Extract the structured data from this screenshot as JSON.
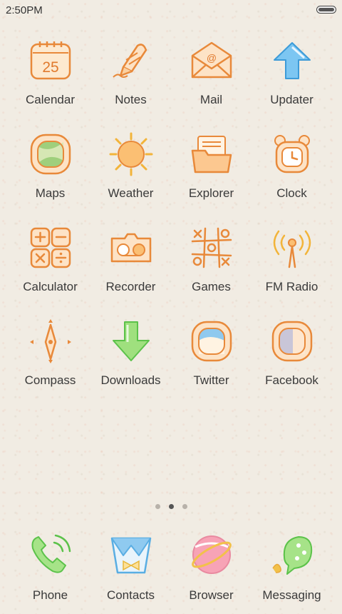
{
  "status_bar": {
    "time": "2:50PM"
  },
  "apps": [
    {
      "label": "Calendar",
      "icon": "calendar-icon",
      "badge": "25"
    },
    {
      "label": "Notes",
      "icon": "notes-icon"
    },
    {
      "label": "Mail",
      "icon": "mail-icon",
      "badge": "@"
    },
    {
      "label": "Updater",
      "icon": "updater-icon"
    },
    {
      "label": "Maps",
      "icon": "maps-icon"
    },
    {
      "label": "Weather",
      "icon": "weather-icon"
    },
    {
      "label": "Explorer",
      "icon": "explorer-icon"
    },
    {
      "label": "Clock",
      "icon": "clock-icon"
    },
    {
      "label": "Calculator",
      "icon": "calculator-icon"
    },
    {
      "label": "Recorder",
      "icon": "recorder-icon"
    },
    {
      "label": "Games",
      "icon": "games-icon"
    },
    {
      "label": "FM Radio",
      "icon": "radio-icon"
    },
    {
      "label": "Compass",
      "icon": "compass-icon"
    },
    {
      "label": "Downloads",
      "icon": "downloads-icon"
    },
    {
      "label": "Twitter",
      "icon": "twitter-icon"
    },
    {
      "label": "Facebook",
      "icon": "facebook-icon"
    }
  ],
  "page_indicator": {
    "count": 3,
    "active": 2
  },
  "dock": [
    {
      "label": "Phone",
      "icon": "phone-icon"
    },
    {
      "label": "Contacts",
      "icon": "contacts-icon"
    },
    {
      "label": "Browser",
      "icon": "browser-icon"
    },
    {
      "label": "Messaging",
      "icon": "messaging-icon"
    }
  ],
  "colors": {
    "orange": "#f0a050",
    "blue": "#4aa8e8",
    "green": "#7ad468",
    "pink": "#f08aa0",
    "background": "#f1ece3"
  }
}
